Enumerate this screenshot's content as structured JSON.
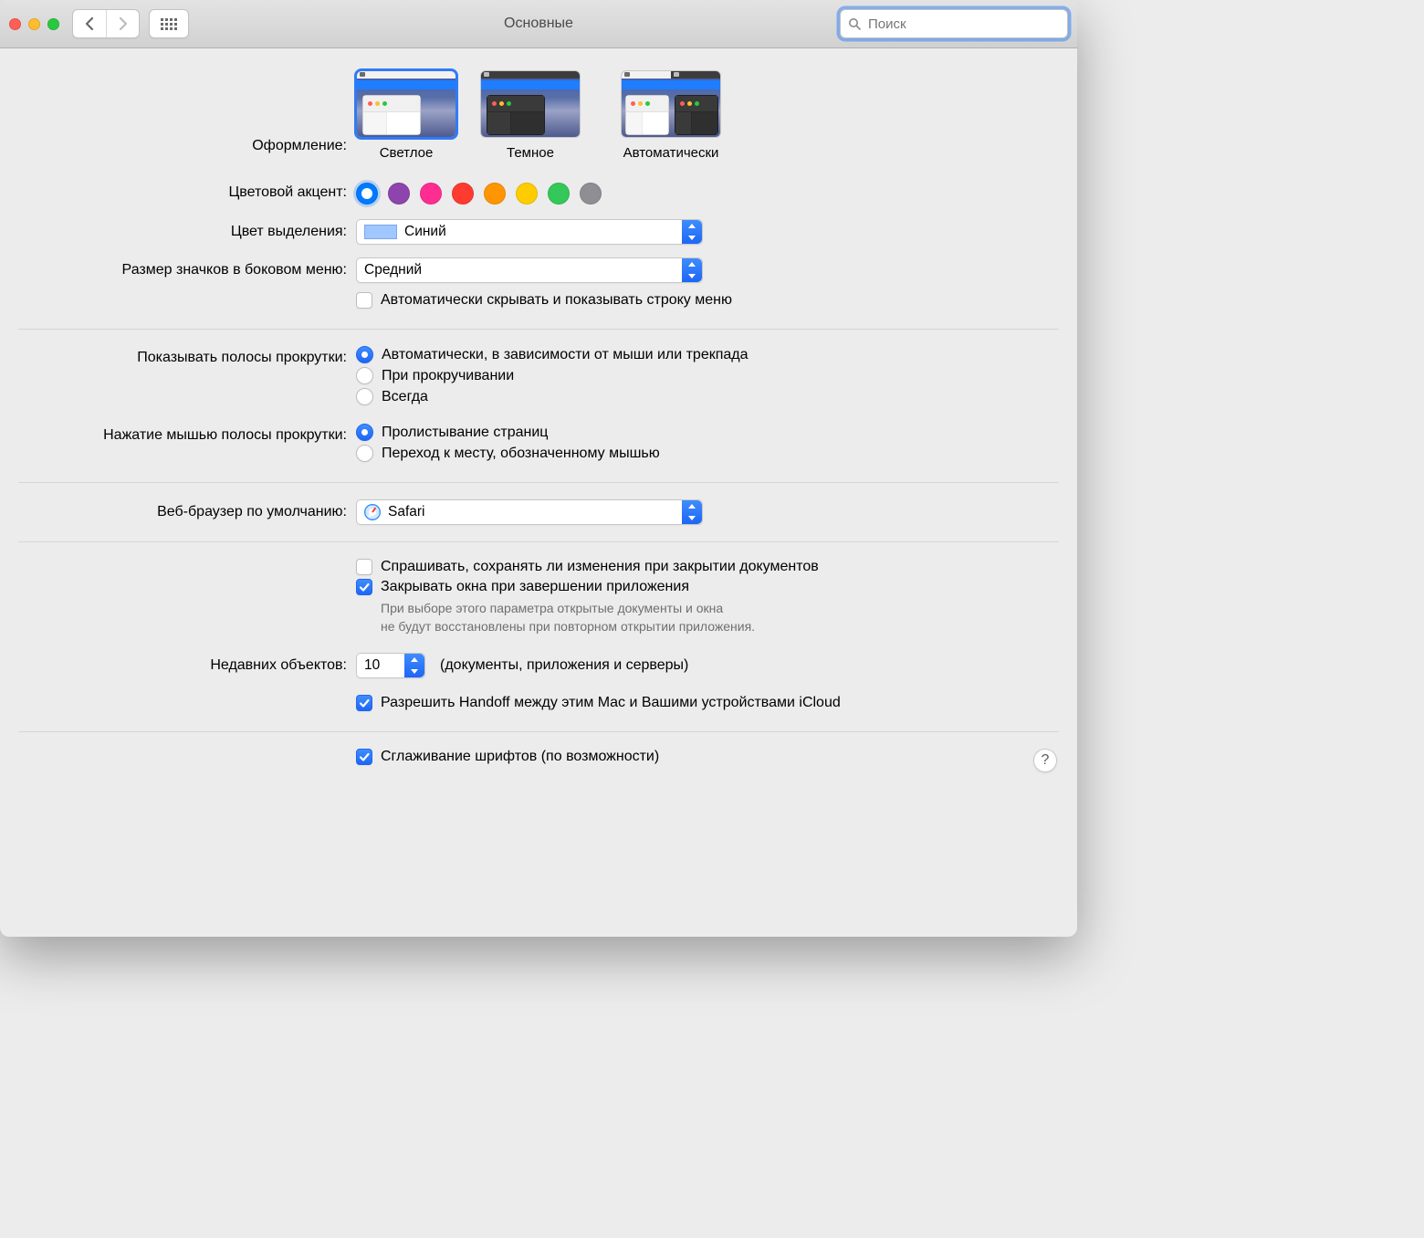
{
  "window": {
    "title": "Основные"
  },
  "search": {
    "placeholder": "Поиск"
  },
  "appearance": {
    "label": "Оформление:",
    "light": "Светлое",
    "dark": "Темное",
    "auto": "Автоматически"
  },
  "accent": {
    "label": "Цветовой акцент:",
    "colors": [
      "#007aff",
      "#8e44ad",
      "#ff2d92",
      "#ff3b30",
      "#ff9500",
      "#ffcc00",
      "#34c759",
      "#8e8e93"
    ],
    "selected_index": 0
  },
  "highlight": {
    "label": "Цвет выделения:",
    "value": "Синий"
  },
  "sidebar_icon": {
    "label": "Размер значков в боковом меню:",
    "value": "Средний"
  },
  "autohide_menubar": "Автоматически скрывать и показывать строку меню",
  "scrollbars": {
    "label": "Показывать полосы прокрутки:",
    "opt1": "Автоматически, в зависимости от мыши или трекпада",
    "opt2": "При прокручивании",
    "opt3": "Всегда"
  },
  "scrollclick": {
    "label": "Нажатие мышью полосы прокрутки:",
    "opt1": "Пролистывание страниц",
    "opt2": "Переход к месту, обозначенному мышью"
  },
  "browser": {
    "label": "Веб-браузер по умолчанию:",
    "value": "Safari"
  },
  "ask_save": "Спрашивать, сохранять ли изменения при закрытии документов",
  "close_windows": "Закрывать окна при завершении приложения",
  "close_windows_desc1": "При выборе этого параметра открытые документы и окна",
  "close_windows_desc2": "не будут восстановлены при повторном открытии приложения.",
  "recent": {
    "label": "Недавних объектов:",
    "value": "10",
    "suffix": "(документы, приложения и серверы)"
  },
  "handoff": "Разрешить Handoff между этим Mac и Вашими устройствами iCloud",
  "font_smoothing": "Сглаживание шрифтов (по возможности)"
}
